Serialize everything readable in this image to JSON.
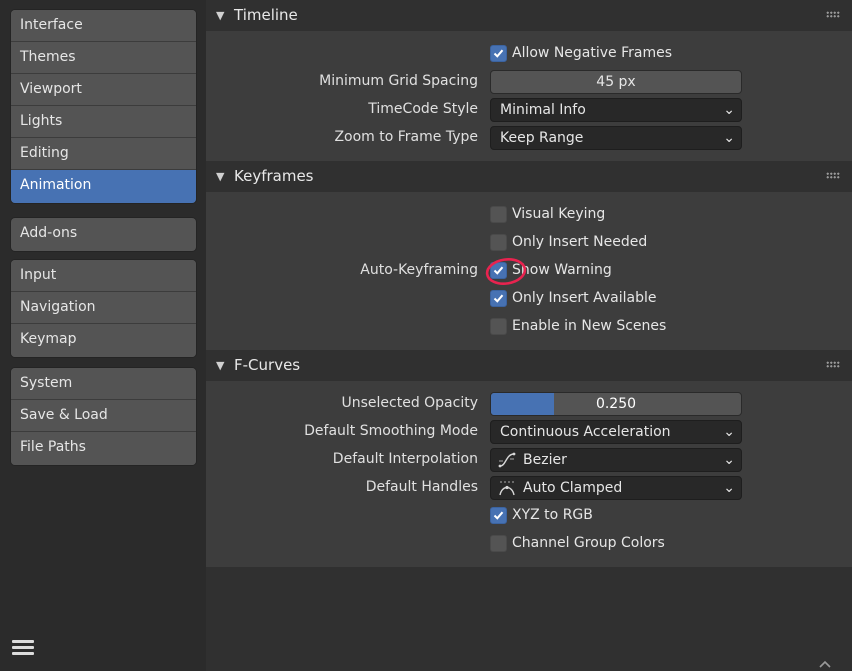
{
  "sidebar": {
    "group1": [
      "Interface",
      "Themes",
      "Viewport",
      "Lights",
      "Editing",
      "Animation"
    ],
    "group2": [
      "Add-ons"
    ],
    "group3": [
      "Input",
      "Navigation",
      "Keymap"
    ],
    "group4": [
      "System",
      "Save & Load",
      "File Paths"
    ],
    "active": "Animation"
  },
  "timeline": {
    "title": "Timeline",
    "allow_negative_frames": {
      "label": "Allow Negative Frames",
      "checked": true
    },
    "min_grid_spacing": {
      "label": "Minimum Grid Spacing",
      "value": "45 px"
    },
    "timecode_style": {
      "label": "TimeCode Style",
      "value": "Minimal Info"
    },
    "zoom_to_frame_type": {
      "label": "Zoom to Frame Type",
      "value": "Keep Range"
    }
  },
  "keyframes": {
    "title": "Keyframes",
    "auto_label": "Auto-Keyframing",
    "visual_keying": {
      "label": "Visual Keying",
      "checked": false
    },
    "only_insert_needed": {
      "label": "Only Insert Needed",
      "checked": false
    },
    "show_warning": {
      "label": "Show Warning",
      "checked": true
    },
    "only_insert_available": {
      "label": "Only Insert Available",
      "checked": true
    },
    "enable_in_new_scenes": {
      "label": "Enable in New Scenes",
      "checked": false
    }
  },
  "fcurves": {
    "title": "F-Curves",
    "unselected_opacity": {
      "label": "Unselected Opacity",
      "value": "0.250",
      "fraction": 0.25
    },
    "default_smoothing_mode": {
      "label": "Default Smoothing Mode",
      "value": "Continuous Acceleration"
    },
    "default_interpolation": {
      "label": "Default Interpolation",
      "value": "Bezier",
      "icon": "bezier-curve-icon"
    },
    "default_handles": {
      "label": "Default Handles",
      "value": "Auto Clamped",
      "icon": "auto-clamped-handle-icon"
    },
    "xyz_to_rgb": {
      "label": "XYZ to RGB",
      "checked": true
    },
    "channel_group_colors": {
      "label": "Channel Group Colors",
      "checked": false
    }
  },
  "colors": {
    "accent": "#4772b3",
    "annotation": "#e8234f"
  }
}
